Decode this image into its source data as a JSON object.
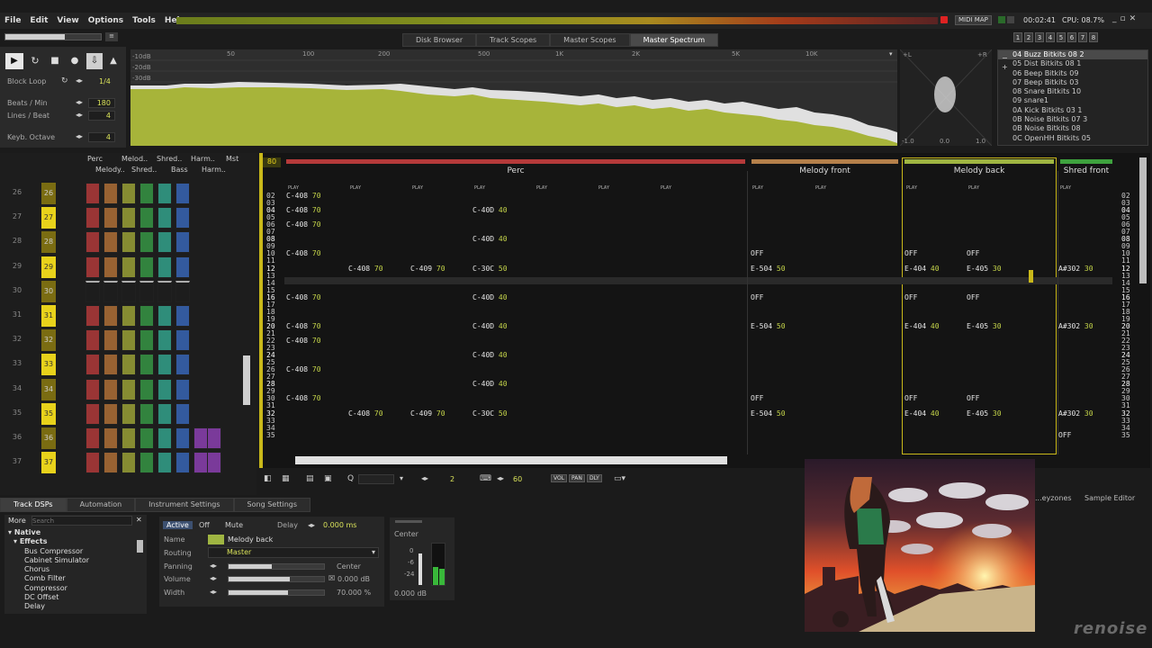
{
  "menu": [
    "File",
    "Edit",
    "View",
    "Options",
    "Tools",
    "Help"
  ],
  "status": {
    "midi_map": "MIDI MAP",
    "time": "00:02:41",
    "cpu": "CPU: 08.7%"
  },
  "top_tabs": [
    "Disk Browser",
    "Track Scopes",
    "Master Scopes",
    "Master Spectrum"
  ],
  "top_tab_active": "Master Spectrum",
  "num_tabs": [
    "1",
    "2",
    "3",
    "4",
    "5",
    "6",
    "7",
    "8"
  ],
  "controls": {
    "block_loop_label": "Block Loop",
    "block_loop_value": "1/4",
    "bpm_label": "Beats / Min",
    "bpm_value": "180",
    "lpb_label": "Lines / Beat",
    "lpb_value": "4",
    "octave_label": "Keyb. Octave",
    "octave_value": "4"
  },
  "spectrum": {
    "db_labels": [
      "-10dB",
      "-20dB",
      "-30dB"
    ],
    "freq_labels": [
      "50",
      "100",
      "200",
      "500",
      "1K",
      "2K",
      "5K",
      "10K"
    ],
    "scope_labels": [
      "-1.0",
      "0.0",
      "1.0",
      "+L",
      "+R"
    ]
  },
  "instruments": [
    {
      "id": "04",
      "name": "Buzz Bitkits 08 2",
      "sel": true
    },
    {
      "id": "05",
      "name": "Dist Bitkits 08 1"
    },
    {
      "id": "06",
      "name": "Beep Bitkits 09"
    },
    {
      "id": "07",
      "name": "Beep Bitkits 03"
    },
    {
      "id": "08",
      "name": "Snare Bitkits 10"
    },
    {
      "id": "09",
      "name": "snare1"
    },
    {
      "id": "0A",
      "name": "Kick Bitkits 03 1"
    },
    {
      "id": "0B",
      "name": "Noise Bitkits 07 3"
    },
    {
      "id": "0B",
      "name": "Noise Bitkits 08"
    },
    {
      "id": "0C",
      "name": "OpenHH Bitkits 05"
    }
  ],
  "seq_columns": [
    "Perc",
    "Melod..",
    "Shred..",
    "Harm..",
    "Mst",
    "Melody..",
    "Shred..",
    "Bass",
    "Harm.."
  ],
  "sequence": [
    "26",
    "27",
    "28",
    "29",
    "30",
    "31",
    "32",
    "33",
    "34",
    "35",
    "36",
    "37"
  ],
  "pattern": {
    "number": "80",
    "tracks": [
      {
        "name": "Perc",
        "color": "#b53a3a"
      },
      {
        "name": "Melody front",
        "color": "#b5804a"
      },
      {
        "name": "Melody back",
        "color": "#9fb542"
      },
      {
        "name": "Shred front",
        "color": "#3ea23e"
      }
    ],
    "play_label": "PLAY",
    "rows": [
      "02",
      "03",
      "04",
      "05",
      "06",
      "07",
      "08",
      "09",
      "10",
      "11",
      "12",
      "13",
      "14",
      "15",
      "16",
      "17",
      "18",
      "19",
      "20",
      "21",
      "22",
      "23",
      "24",
      "25",
      "26",
      "27",
      "28",
      "29",
      "30",
      "31",
      "32",
      "33",
      "34",
      "35"
    ],
    "notes": [
      {
        "row": 2,
        "col": 0,
        "n": "C-408",
        "v": "70"
      },
      {
        "row": 4,
        "col": 0,
        "n": "C-408",
        "v": "70"
      },
      {
        "row": 4,
        "col": 3,
        "n": "C-40D",
        "v": "40"
      },
      {
        "row": 6,
        "col": 0,
        "n": "C-408",
        "v": "70"
      },
      {
        "row": 8,
        "col": 3,
        "n": "C-40D",
        "v": "40"
      },
      {
        "row": 10,
        "col": 0,
        "n": "C-408",
        "v": "70"
      },
      {
        "row": 10,
        "col": 4,
        "n": "OFF",
        "v": ""
      },
      {
        "row": 10,
        "col": 6,
        "n": "OFF",
        "v": ""
      },
      {
        "row": 10,
        "col": 7,
        "n": "OFF",
        "v": ""
      },
      {
        "row": 12,
        "col": 1,
        "n": "C-408",
        "v": "70"
      },
      {
        "row": 12,
        "col": 2,
        "n": "C-409",
        "v": "70"
      },
      {
        "row": 12,
        "col": 3,
        "n": "C-30C",
        "v": "50"
      },
      {
        "row": 12,
        "col": 4,
        "n": "E-504",
        "v": "50"
      },
      {
        "row": 12,
        "col": 6,
        "n": "E-404",
        "v": "40"
      },
      {
        "row": 12,
        "col": 7,
        "n": "E-405",
        "v": "30"
      },
      {
        "row": 12,
        "col": 8,
        "n": "A#302",
        "v": "30"
      },
      {
        "row": 16,
        "col": 0,
        "n": "C-408",
        "v": "70"
      },
      {
        "row": 16,
        "col": 3,
        "n": "C-40D",
        "v": "40"
      },
      {
        "row": 16,
        "col": 4,
        "n": "OFF",
        "v": ""
      },
      {
        "row": 16,
        "col": 6,
        "n": "OFF",
        "v": ""
      },
      {
        "row": 16,
        "col": 7,
        "n": "OFF",
        "v": ""
      },
      {
        "row": 20,
        "col": 0,
        "n": "C-408",
        "v": "70"
      },
      {
        "row": 20,
        "col": 3,
        "n": "C-40D",
        "v": "40"
      },
      {
        "row": 20,
        "col": 4,
        "n": "E-504",
        "v": "50"
      },
      {
        "row": 20,
        "col": 6,
        "n": "E-404",
        "v": "40"
      },
      {
        "row": 20,
        "col": 7,
        "n": "E-405",
        "v": "30"
      },
      {
        "row": 20,
        "col": 8,
        "n": "A#302",
        "v": "30"
      },
      {
        "row": 22,
        "col": 0,
        "n": "C-408",
        "v": "70"
      },
      {
        "row": 24,
        "col": 3,
        "n": "C-40D",
        "v": "40"
      },
      {
        "row": 26,
        "col": 0,
        "n": "C-408",
        "v": "70"
      },
      {
        "row": 28,
        "col": 3,
        "n": "C-40D",
        "v": "40"
      },
      {
        "row": 30,
        "col": 0,
        "n": "C-408",
        "v": "70"
      },
      {
        "row": 30,
        "col": 4,
        "n": "OFF",
        "v": ""
      },
      {
        "row": 30,
        "col": 6,
        "n": "OFF",
        "v": ""
      },
      {
        "row": 30,
        "col": 7,
        "n": "OFF",
        "v": ""
      },
      {
        "row": 32,
        "col": 1,
        "n": "C-408",
        "v": "70"
      },
      {
        "row": 32,
        "col": 2,
        "n": "C-409",
        "v": "70"
      },
      {
        "row": 32,
        "col": 3,
        "n": "C-30C",
        "v": "50"
      },
      {
        "row": 32,
        "col": 4,
        "n": "E-504",
        "v": "50"
      },
      {
        "row": 32,
        "col": 6,
        "n": "E-404",
        "v": "40"
      },
      {
        "row": 32,
        "col": 7,
        "n": "E-405",
        "v": "30"
      },
      {
        "row": 32,
        "col": 8,
        "n": "A#302",
        "v": "30"
      },
      {
        "row": 35,
        "col": 8,
        "n": "OFF",
        "v": ""
      }
    ]
  },
  "toolbar2": {
    "step": "2",
    "edit_step": "60",
    "buttons": [
      "VOL",
      "PAN",
      "DLY"
    ]
  },
  "bottom_tabs": [
    "Track DSPs",
    "Automation",
    "Instrument Settings",
    "Song Settings"
  ],
  "right_tabs": [
    "...eyzones",
    "Sample Editor"
  ],
  "dsp": {
    "more": "More",
    "search_placeholder": "Search",
    "items": [
      "Native",
      "Effects",
      "Bus Compressor",
      "Cabinet Simulator",
      "Chorus",
      "Comb Filter",
      "Compressor",
      "DC Offset",
      "Delay"
    ]
  },
  "params": {
    "active": "Active",
    "off": "Off",
    "mute": "Mute",
    "delay_label": "Delay",
    "delay_value": "0.000 ms",
    "name_label": "Name",
    "name_value": "Melody back",
    "routing_label": "Routing",
    "routing_value": "Master",
    "panning_label": "Panning",
    "panning_value": "Center",
    "volume_label": "Volume",
    "volume_value": "0.000 dB",
    "width_label": "Width",
    "width_value": "70.000 %"
  },
  "master": {
    "pan": "Center",
    "levels": [
      "0",
      "-6",
      "-24"
    ],
    "db": "0.000 dB"
  },
  "logo": "renoise"
}
